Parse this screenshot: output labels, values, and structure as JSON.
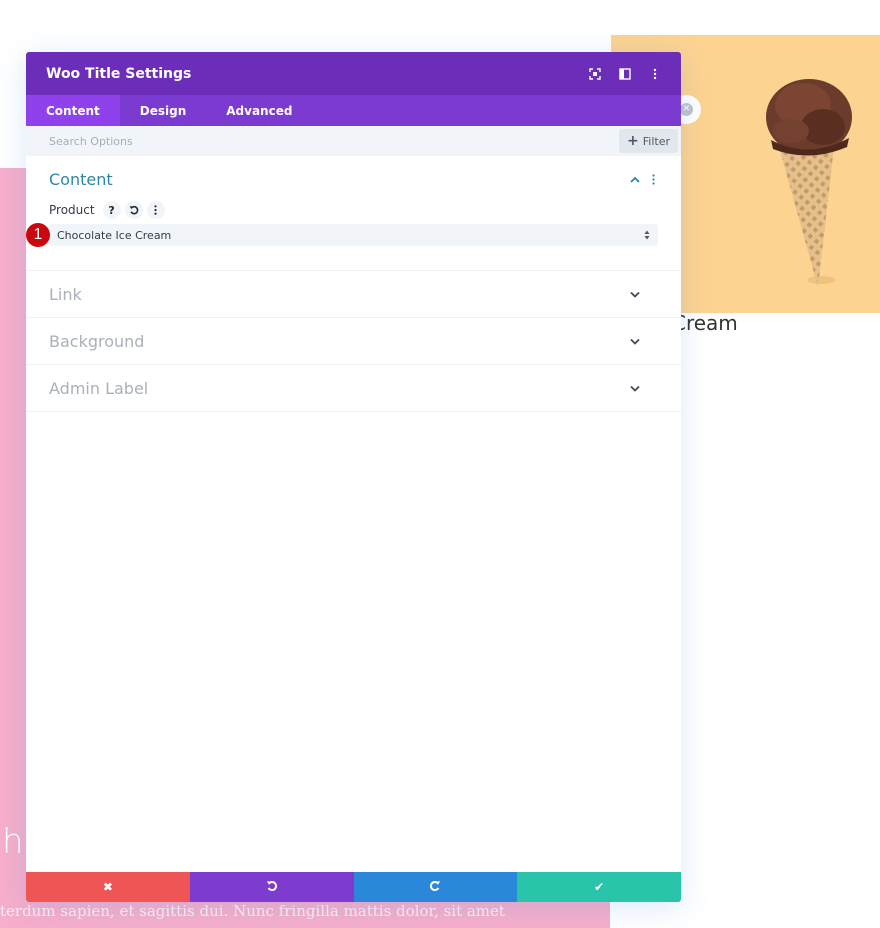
{
  "modal": {
    "title": "Woo Title Settings",
    "header_icons": [
      "expand-icon",
      "split-view-icon",
      "more-options-icon"
    ],
    "tabs": [
      {
        "label": "Content",
        "active": true
      },
      {
        "label": "Design",
        "active": false
      },
      {
        "label": "Advanced",
        "active": false
      }
    ],
    "search": {
      "placeholder": "Search Options",
      "value": ""
    },
    "filter_label": "Filter",
    "groups": [
      {
        "title": "Content",
        "open": true
      },
      {
        "title": "Link",
        "open": false
      },
      {
        "title": "Background",
        "open": false
      },
      {
        "title": "Admin Label",
        "open": false
      }
    ],
    "product_field": {
      "label": "Product",
      "help_glyph": "?",
      "value": "Chocolate Ice Cream",
      "step_badge": "1"
    },
    "footer": {
      "discard": "✖",
      "undo": "↶",
      "redo": "↷",
      "save": "✔"
    }
  },
  "background": {
    "product_title": "Chocolate Ice Cream",
    "visible_title_fragment": "ate Ice Cream",
    "heading_fragment": "h",
    "paragraph_fragment": "terdum sapien, et sagittis dui. Nunc fringilla mattis dolor, sit amet",
    "colors": {
      "pink": "#f7aecb",
      "image_bg": "#fdd391"
    }
  },
  "colors": {
    "header": "#6c2eb9",
    "tabs": "#7b3bd1",
    "tab_active": "#8f42ec",
    "discard": "#ef5555",
    "undo": "#7e3bd0",
    "redo": "#2b87da",
    "save": "#29c4a9",
    "badge": "#c9070f"
  }
}
